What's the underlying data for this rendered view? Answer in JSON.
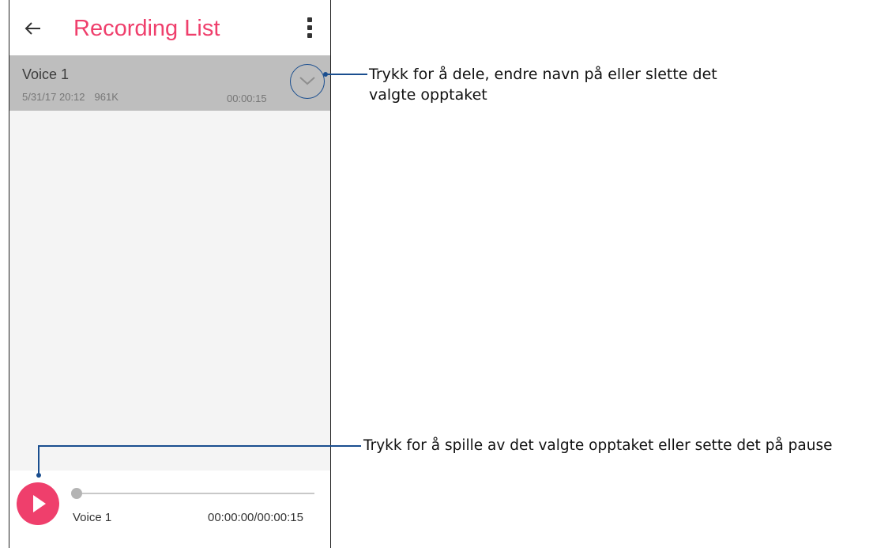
{
  "app_bar": {
    "back_icon": "arrow-left-icon",
    "title": "Recording List",
    "menu_icon": "more-vertical-icon"
  },
  "recording": {
    "name": "Voice 1",
    "datetime": "5/31/17 20:12",
    "size": "961K",
    "duration": "00:00:15",
    "expand_icon": "chevron-down-icon"
  },
  "player": {
    "play_icon": "play-icon",
    "name": "Voice 1",
    "time": "00:00:00/00:00:15",
    "progress": 0
  },
  "callouts": {
    "options": "Trykk for å dele, endre navn på eller slette det valgte opptaket",
    "play": "Trykk for å spille av det valgte opptaket eller sette det på pause"
  },
  "colors": {
    "accent": "#ef3f6c",
    "callout": "#1a4e8f",
    "selected_row": "#bebebe"
  }
}
